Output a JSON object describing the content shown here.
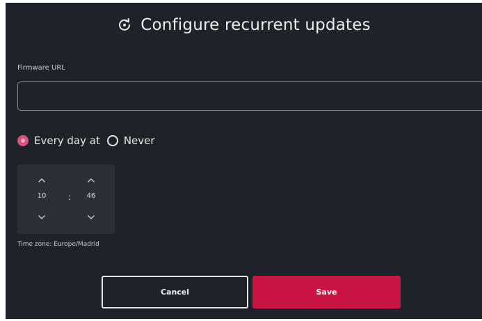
{
  "dialog": {
    "title": "Configure recurrent updates",
    "title_icon": "refresh-icon"
  },
  "form": {
    "firmware_url_label": "Firmware URL",
    "firmware_url_value": "",
    "firmware_url_placeholder": ""
  },
  "schedule": {
    "options": [
      {
        "label": "Every day at",
        "checked": true
      },
      {
        "label": "Never",
        "checked": false
      }
    ],
    "time": {
      "hours": "10",
      "minutes": "46",
      "separator": ":"
    },
    "timezone_text": "Time zone: Europe/Madrid"
  },
  "actions": {
    "cancel_label": "Cancel",
    "save_label": "Save"
  },
  "colors": {
    "background": "#1f2228",
    "accent": "#cc1544",
    "radio_checked": "#d8527c",
    "time_box": "#2b2f36"
  }
}
